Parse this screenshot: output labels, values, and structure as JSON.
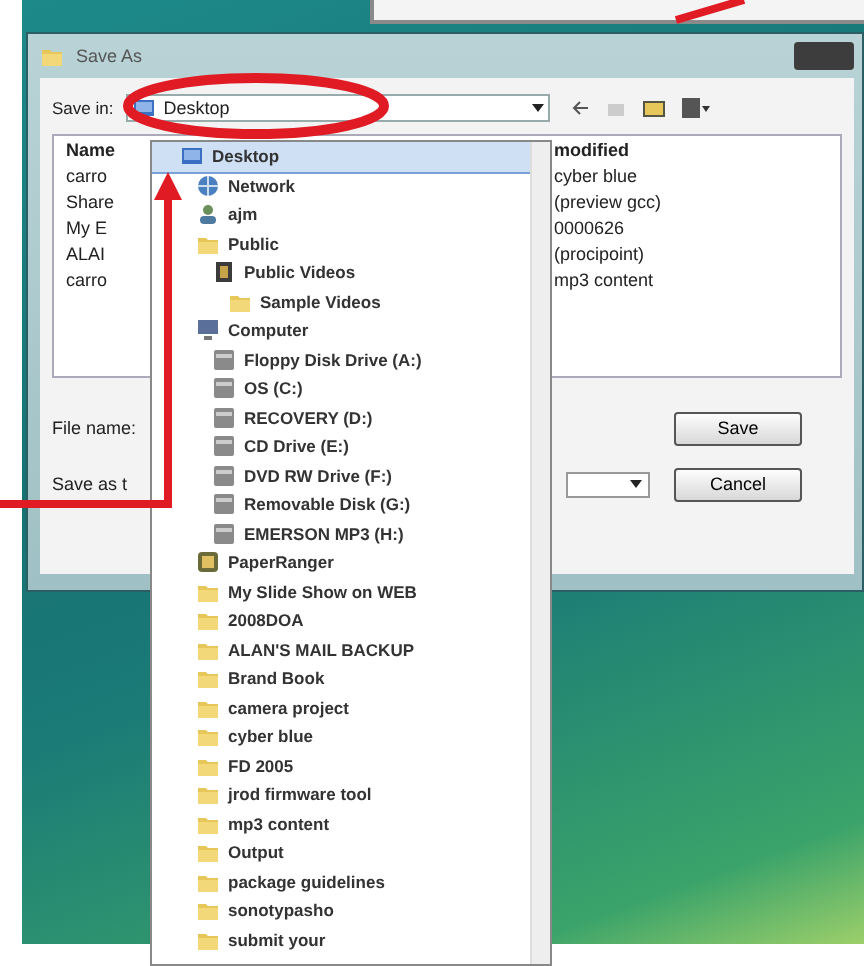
{
  "dialog": {
    "title": "Save As",
    "save_in_label": "Save in:",
    "location": "Desktop",
    "columns": [
      {
        "label": "Name"
      },
      {
        "label": "modified"
      }
    ],
    "files": [
      {
        "name": "carro",
        "column_2": "cyber blue"
      },
      {
        "name": "Share",
        "column_2": "(preview gcc)"
      },
      {
        "name": "My E",
        "column_2": "0000626"
      },
      {
        "name": "ALAI",
        "column_2": "(procipoint)"
      },
      {
        "name": "carro",
        "column_2": "mp3 content"
      }
    ],
    "file_name_label": "File name:",
    "save_type_label": "Save as t",
    "buttons": [
      {
        "label": "Save"
      },
      {
        "label": "Cancel"
      }
    ]
  },
  "dropdown": {
    "items": [
      {
        "label": "Desktop",
        "kind": "desktop",
        "selected": true,
        "children": [
          {
            "label": "Network",
            "kind": "network",
            "selected": false
          },
          {
            "label": "ajm",
            "kind": "user",
            "selected": false
          },
          {
            "label": "Public",
            "kind": "folder",
            "selected": false,
            "children": [
              {
                "label": "Public Videos",
                "kind": "video",
                "selected": false,
                "children": [
                  {
                    "label": "Sample Videos",
                    "kind": "folder",
                    "selected": false
                  }
                ]
              }
            ]
          },
          {
            "label": "Computer",
            "kind": "computer",
            "selected": false,
            "children": [
              {
                "label": "Floppy Disk Drive (A:)",
                "kind": "drive",
                "selected": false
              },
              {
                "label": "OS (C:)",
                "kind": "drive",
                "selected": false
              },
              {
                "label": "RECOVERY (D:)",
                "kind": "drive",
                "selected": false
              },
              {
                "label": "CD Drive (E:)",
                "kind": "drive",
                "selected": false
              },
              {
                "label": "DVD RW Drive (F:)",
                "kind": "drive",
                "selected": false
              },
              {
                "label": "Removable Disk (G:)",
                "kind": "drive",
                "selected": false
              },
              {
                "label": "EMERSON MP3 (H:)",
                "kind": "drive",
                "selected": false
              }
            ]
          },
          {
            "label": "PaperRanger",
            "kind": "app",
            "selected": false
          },
          {
            "label": "My Slide Show on WEB",
            "kind": "folder",
            "selected": false
          },
          {
            "label": "2008DOA",
            "kind": "folder",
            "selected": false
          },
          {
            "label": "ALAN'S MAIL BACKUP",
            "kind": "folder",
            "selected": false
          },
          {
            "label": "Brand Book",
            "kind": "folder",
            "selected": false
          },
          {
            "label": "camera project",
            "kind": "folder",
            "selected": false
          },
          {
            "label": "cyber blue",
            "kind": "folder",
            "selected": false
          },
          {
            "label": "FD 2005",
            "kind": "folder",
            "selected": false
          },
          {
            "label": "jrod firmware tool",
            "kind": "folder",
            "selected": false
          },
          {
            "label": "mp3 content",
            "kind": "folder",
            "selected": false
          },
          {
            "label": "Output",
            "kind": "folder",
            "selected": false
          },
          {
            "label": "package guidelines",
            "kind": "folder",
            "selected": false
          },
          {
            "label": "sonotypasho",
            "kind": "folder",
            "selected": false
          },
          {
            "label": "submit your",
            "kind": "folder",
            "selected": false
          }
        ]
      }
    ]
  }
}
